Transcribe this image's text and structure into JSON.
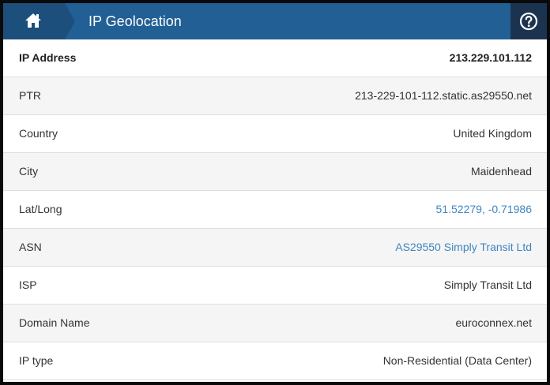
{
  "header": {
    "title": "IP Geolocation",
    "home_icon": "home-icon",
    "help_icon": "question-circle-icon"
  },
  "rows": [
    {
      "label": "IP Address",
      "value": "213.229.101.112"
    },
    {
      "label": "PTR",
      "value": "213-229-101-112.static.as29550.net"
    },
    {
      "label": "Country",
      "value": "United Kingdom"
    },
    {
      "label": "City",
      "value": "Maidenhead"
    },
    {
      "label": "Lat/Long",
      "value": "51.52279, -0.71986",
      "link": true
    },
    {
      "label": "ASN",
      "value": "AS29550 Simply Transit Ltd",
      "link": true
    },
    {
      "label": "ISP",
      "value": "Simply Transit Ltd"
    },
    {
      "label": "Domain Name",
      "value": "euroconnex.net"
    },
    {
      "label": "IP type",
      "value": "Non-Residential (Data Center)"
    }
  ],
  "colors": {
    "header_bg": "#215f95",
    "home_bg": "#1d4f7c",
    "help_bg": "#1c3350",
    "link": "#3f86c1"
  }
}
